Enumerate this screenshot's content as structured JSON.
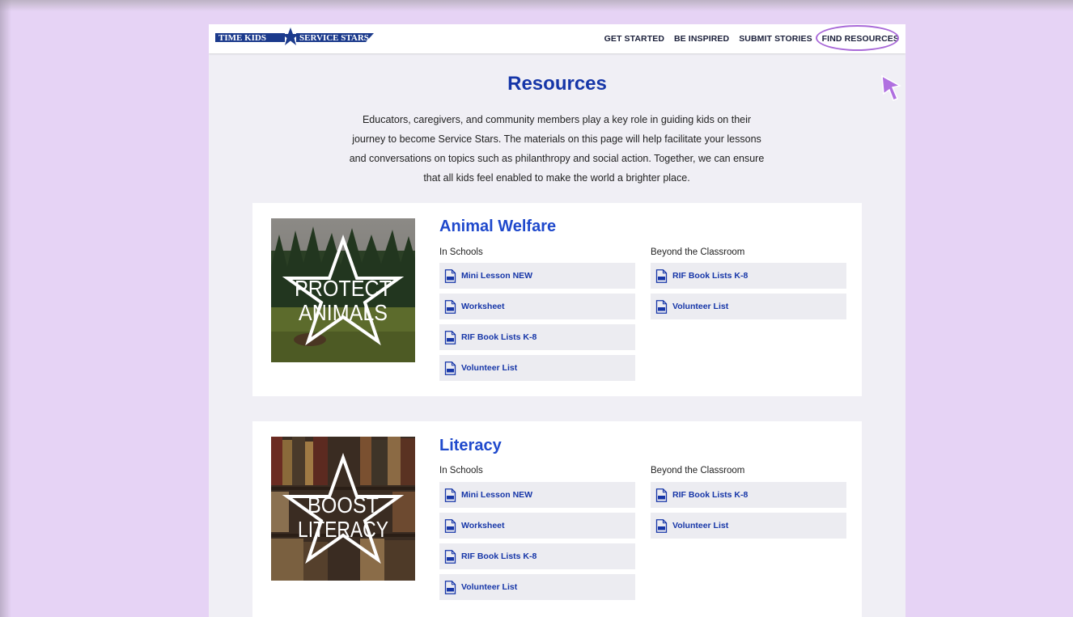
{
  "brand": {
    "logo_left": "TIME KIDS",
    "logo_right": "SERVICE STARS",
    "brand_color": "#1b3a8c"
  },
  "nav": {
    "items": [
      {
        "label": "GET STARTED"
      },
      {
        "label": "BE INSPIRED"
      },
      {
        "label": "SUBMIT STORIES"
      },
      {
        "label": "FIND RESOURCES",
        "active": true
      }
    ],
    "highlight_color": "#a96ad8"
  },
  "page": {
    "title": "Resources",
    "intro": "Educators, caregivers, and community members play a key role in guiding kids on their journey to become Service Stars. The materials on this page will help facilitate your lessons and conversations on topics such as philanthropy and social action. Together, we can ensure that all kids feel enabled to make the world a brighter place."
  },
  "sections": [
    {
      "title": "Animal Welfare",
      "image_text": [
        "PROTECT",
        "ANIMALS"
      ],
      "in_schools_label": "In Schools",
      "beyond_label": "Beyond the Classroom",
      "in_schools": [
        "Mini Lesson NEW",
        "Worksheet",
        "RIF Book Lists K-8",
        "Volunteer List"
      ],
      "beyond": [
        "RIF Book Lists K-8",
        "Volunteer List"
      ]
    },
    {
      "title": "Literacy",
      "image_text": [
        "BOOST",
        "LITERACY"
      ],
      "in_schools_label": "In Schools",
      "beyond_label": "Beyond the Classroom",
      "in_schools": [
        "Mini Lesson NEW",
        "Worksheet",
        "RIF Book Lists K-8",
        "Volunteer List"
      ],
      "beyond": [
        "RIF Book Lists K-8",
        "Volunteer List"
      ]
    }
  ],
  "colors": {
    "accent": "#1f49cc",
    "link": "#1636a8",
    "background": "#e6d3f5"
  },
  "icons": [
    "pdf-icon",
    "cursor-arrow-icon",
    "star-icon"
  ]
}
